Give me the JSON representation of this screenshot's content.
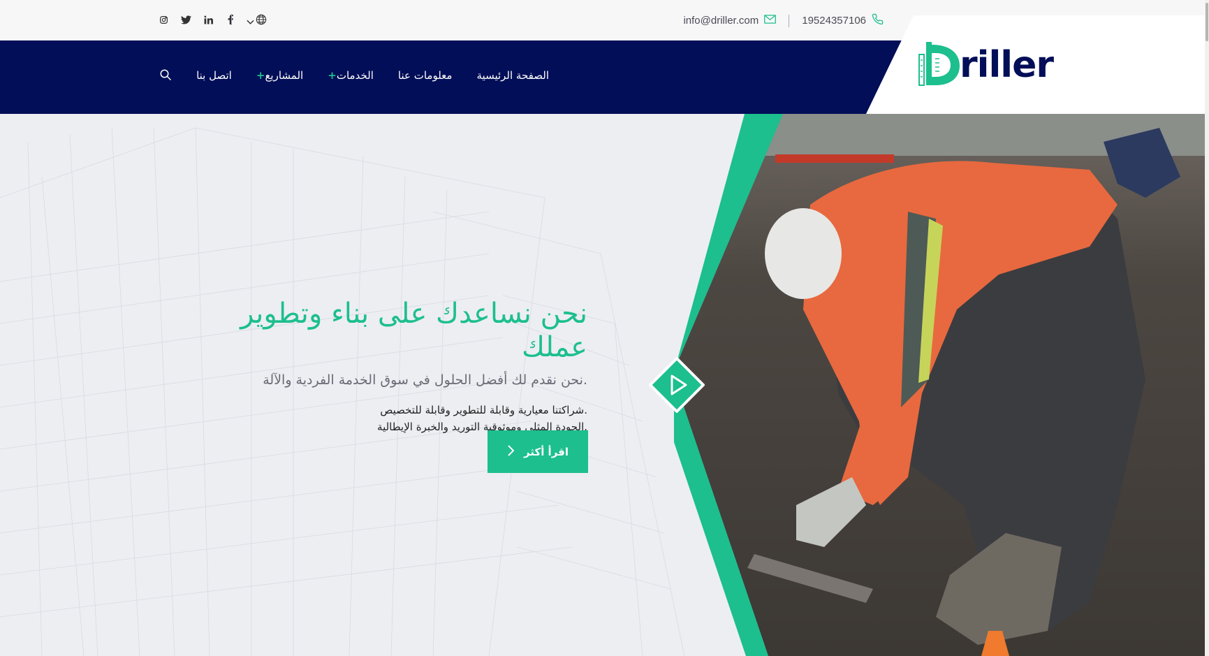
{
  "topbar": {
    "phone": "19524357106",
    "email": "info@driller.com",
    "social": [
      "instagram-icon",
      "twitter-icon",
      "linkedin-icon",
      "facebook-icon"
    ]
  },
  "nav": {
    "items": [
      {
        "label": "الصفحة الرئيسية",
        "has_plus": false
      },
      {
        "label": "معلومات عنا",
        "has_plus": false
      },
      {
        "label": "الخدمات",
        "has_plus": true
      },
      {
        "label": "المشاريع",
        "has_plus": true
      },
      {
        "label": "اتصل بنا",
        "has_plus": false
      }
    ]
  },
  "brand": {
    "name": "riller",
    "initial": "D"
  },
  "hero": {
    "title": "نحن نساعدك على بناء وتطوير عملك",
    "subtitle": ".نحن نقدم لك أفضل الحلول في سوق الخدمة الفردية والآلة",
    "desc_line1": ".شراكتنا معيارية وقابلة للتطوير وقابلة للتخصيص",
    "desc_line2": ".الجودة المثلى وموثوقية التوريد والخبرة الإيطالية",
    "cta_label": "اقرأ أكثر"
  },
  "colors": {
    "navy": "#020e57",
    "accent": "#1cbf8d"
  }
}
